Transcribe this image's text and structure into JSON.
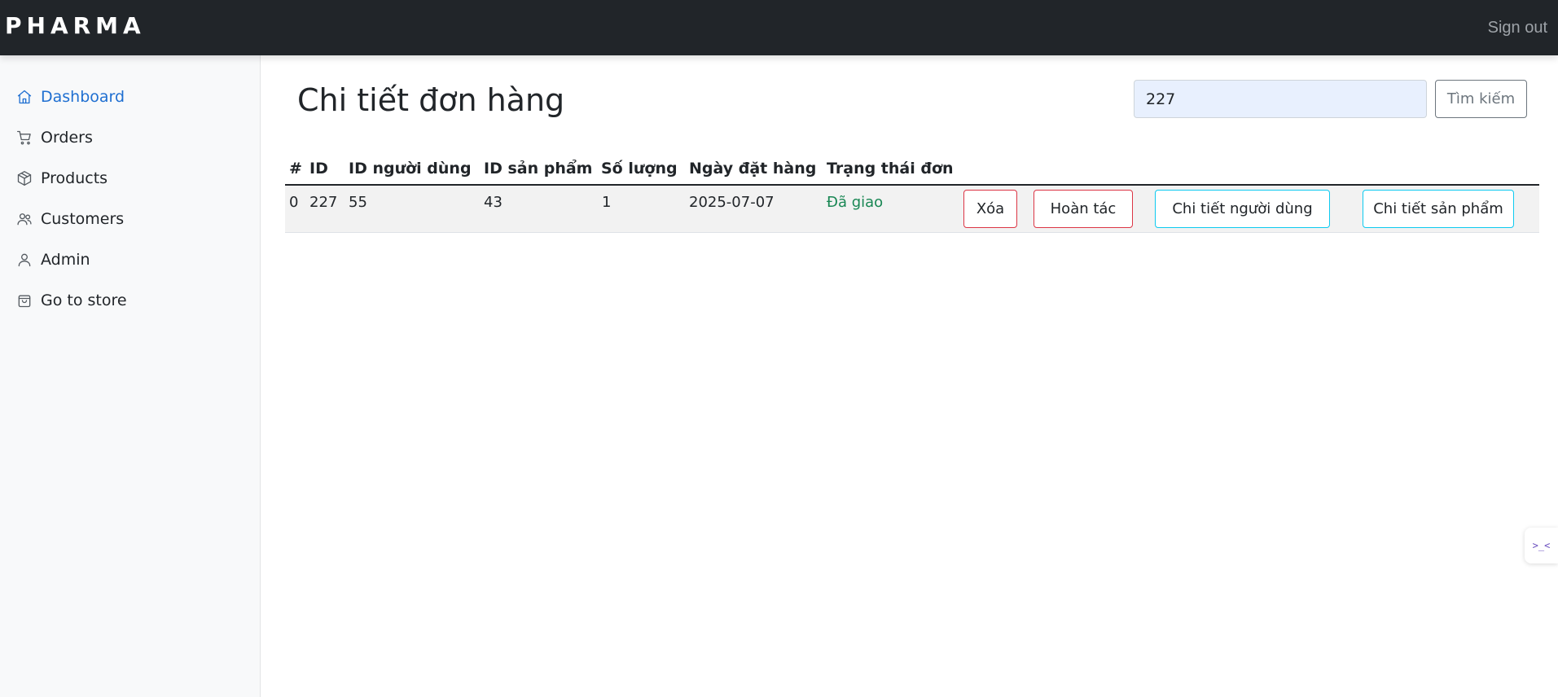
{
  "header": {
    "brand": "PHARMA",
    "signout_label": "Sign out"
  },
  "sidebar": {
    "items": [
      {
        "label": "Dashboard",
        "icon": "home-icon",
        "active": true
      },
      {
        "label": "Orders",
        "icon": "cart-icon",
        "active": false
      },
      {
        "label": "Products",
        "icon": "package-icon",
        "active": false
      },
      {
        "label": "Customers",
        "icon": "users-icon",
        "active": false
      },
      {
        "label": "Admin",
        "icon": "user-icon",
        "active": false
      },
      {
        "label": "Go to store",
        "icon": "shopping-bag-icon",
        "active": false
      }
    ]
  },
  "main": {
    "title": "Chi tiết đơn hàng",
    "search": {
      "value": "227",
      "button_label": "Tìm kiếm"
    },
    "table": {
      "headers": [
        "#",
        "ID",
        "ID người dùng",
        "ID sản phẩm",
        "Số lượng",
        "Ngày đặt hàng",
        "Trạng thái đơn"
      ],
      "rows": [
        {
          "index": "0",
          "id": "227",
          "user_id": "55",
          "product_id": "43",
          "quantity": "1",
          "order_date": "2025-07-07",
          "status": "Đã giao",
          "actions": {
            "delete": "Xóa",
            "undo": "Hoàn tác",
            "user_detail": "Chi tiết người dùng",
            "product_detail": "Chi tiết sản phẩm"
          }
        }
      ]
    }
  },
  "colors": {
    "topbar": "#212529",
    "active_link": "#1f6fd1",
    "status_delivered": "#198754",
    "danger": "#dc3545",
    "info": "#0dcaf0"
  },
  "floating_widget": {
    "text": ">_<"
  }
}
